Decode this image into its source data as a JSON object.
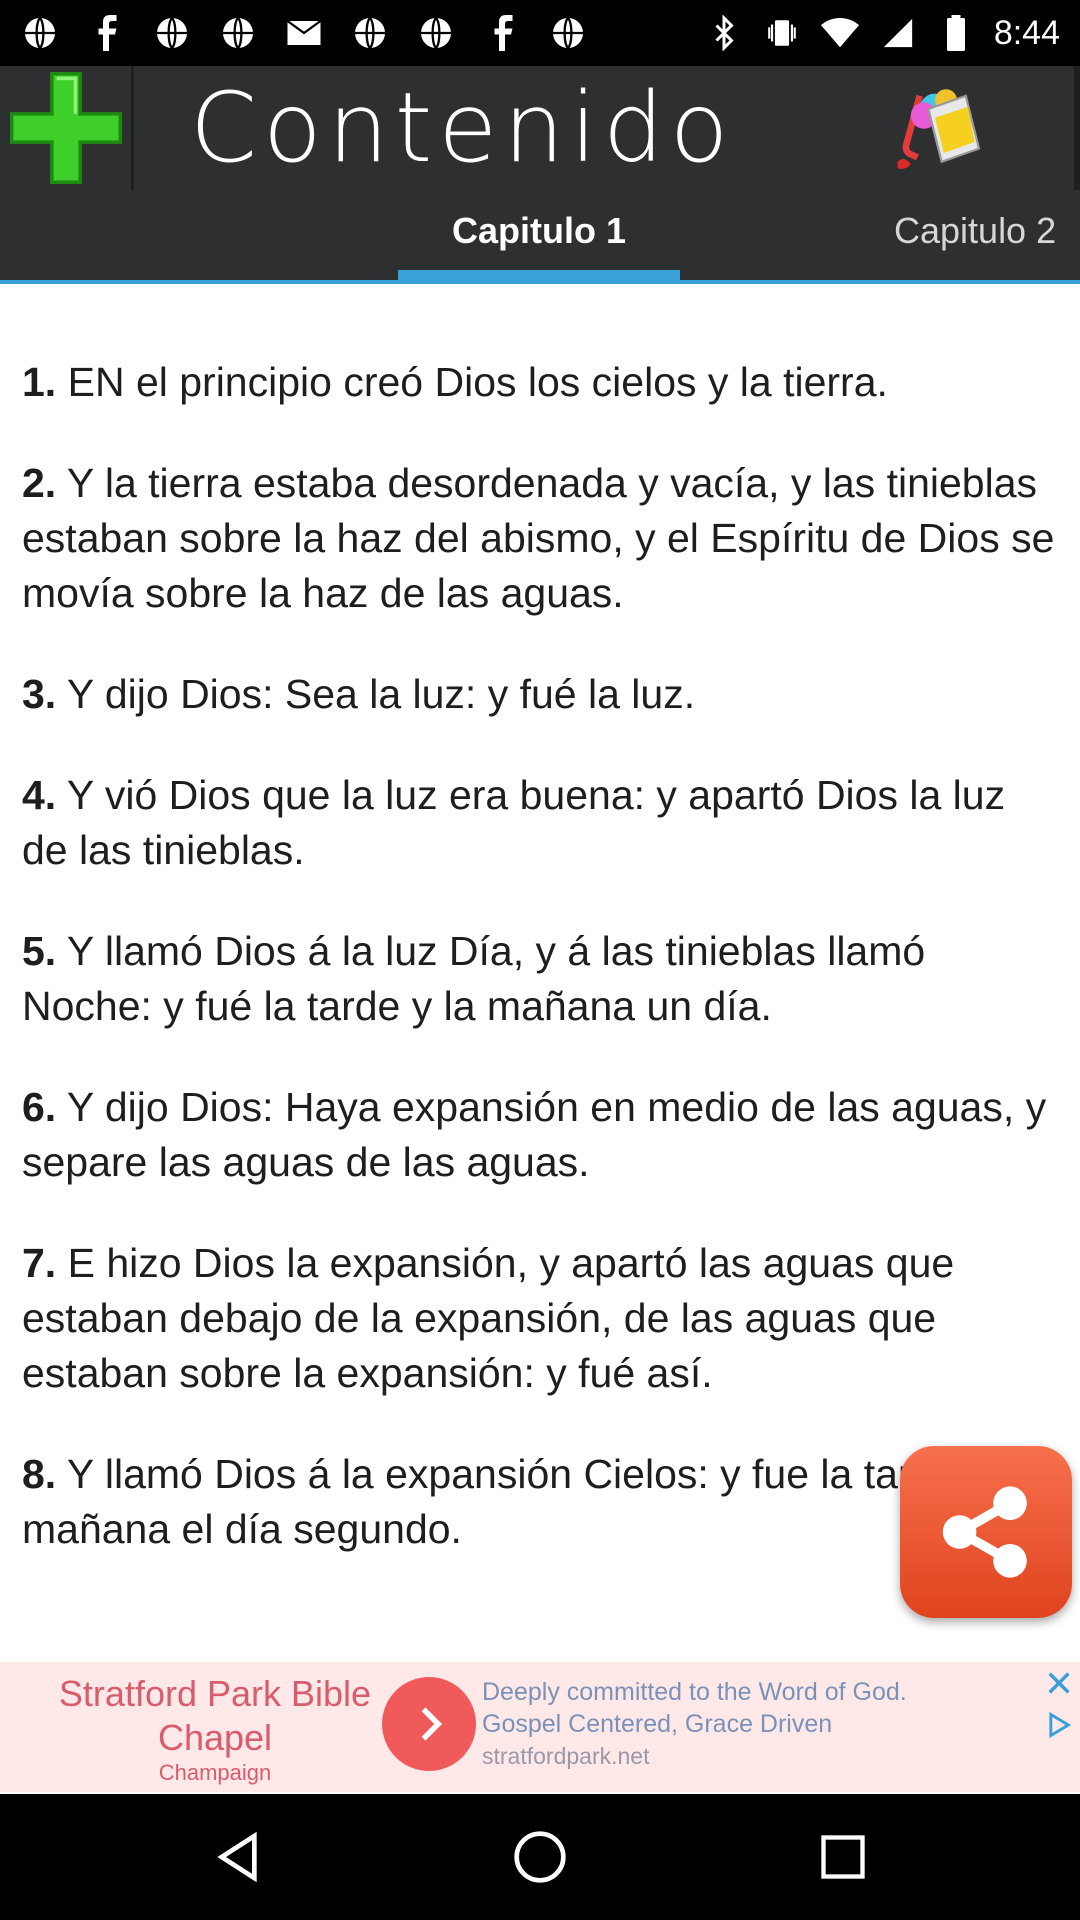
{
  "status_bar": {
    "time": "8:44",
    "left_icons": [
      "globe-icon",
      "globe-icon",
      "facebook-icon",
      "globe-icon",
      "globe-icon",
      "email-icon",
      "globe-icon",
      "globe-icon",
      "facebook-icon",
      "globe-icon"
    ],
    "right_icons": [
      "bluetooth-icon",
      "vibrate-icon",
      "wifi-icon",
      "signal-icon",
      "battery-icon"
    ]
  },
  "app_bar": {
    "title": "Contenido"
  },
  "tabs": [
    {
      "label": "Capitulo 1",
      "active": true
    },
    {
      "label": "Capitulo 2",
      "active": false
    }
  ],
  "verses": [
    {
      "num": "1.",
      "text": " EN el principio creó Dios los cielos y la tierra."
    },
    {
      "num": "2.",
      "text": " Y la tierra estaba desordenada y vacía, y las tinieblas estaban sobre la haz del abismo, y el Espíritu de Dios se movía sobre la haz de las aguas."
    },
    {
      "num": "3.",
      "text": " Y dijo Dios: Sea la luz: y fué la luz."
    },
    {
      "num": "4.",
      "text": " Y vió Dios que la luz era buena: y apartó Dios la luz de las tinieblas."
    },
    {
      "num": "5.",
      "text": " Y llamó Dios á la luz Día, y á las tinieblas llamó Noche: y fué la tarde y la mañana un día."
    },
    {
      "num": "6.",
      "text": " Y dijo Dios: Haya expansión en medio de las aguas, y separe las aguas de las aguas."
    },
    {
      "num": "7.",
      "text": " E hizo Dios la expansión, y apartó las aguas que estaban debajo de la expansión, de las aguas que estaban sobre la expansión: y fué así."
    },
    {
      "num": "8.",
      "text": " Y llamó Dios á la expansión Cielos: y fue la tarde y la mañana el día segundo."
    }
  ],
  "ad": {
    "title": "Stratford Park Bible Chapel",
    "subtitle": "Champaign",
    "line1": "Deeply committed to the Word of God.",
    "line2": "Gospel Centered, Grace Driven",
    "url": "stratfordpark.net"
  },
  "colors": {
    "app_bar": "#2d2f30",
    "tab_accent": "#3aa0d8",
    "add_icon": "#3fcf2a",
    "share_button": "#ef5a33",
    "ad_background": "#ffe8e8"
  }
}
